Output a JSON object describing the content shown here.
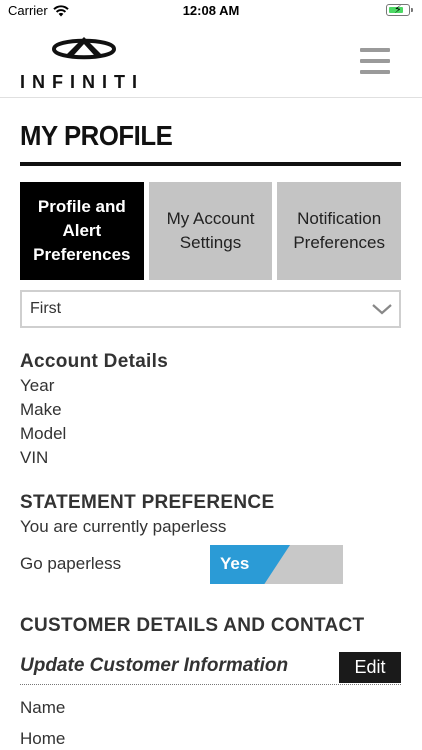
{
  "status_bar": {
    "carrier": "Carrier",
    "time": "12:08 AM"
  },
  "brand": {
    "name": "INFINITI"
  },
  "page": {
    "title": "MY PROFILE"
  },
  "tabs": [
    {
      "label": "Profile and Alert Preferences",
      "active": true
    },
    {
      "label": "My Account Settings",
      "active": false
    },
    {
      "label": "Notification Preferences",
      "active": false
    }
  ],
  "vehicle_select": {
    "value": "First"
  },
  "account_details": {
    "heading": "Account Details",
    "fields": [
      "Year",
      "Make",
      "Model",
      "VIN"
    ]
  },
  "statement": {
    "heading": "STATEMENT PREFERENCE",
    "status_text": "You are currently paperless",
    "toggle_label": "Go paperless",
    "toggle_value": "Yes"
  },
  "customer": {
    "heading": "CUSTOMER DETAILS AND CONTACT",
    "subheading": "Update Customer Information",
    "edit_label": "Edit",
    "fields": [
      "Name",
      "Home"
    ]
  },
  "colors": {
    "toggle_on": "#2b9bd6",
    "tab_active": "#000000",
    "tab_inactive": "#c4c4c4"
  }
}
